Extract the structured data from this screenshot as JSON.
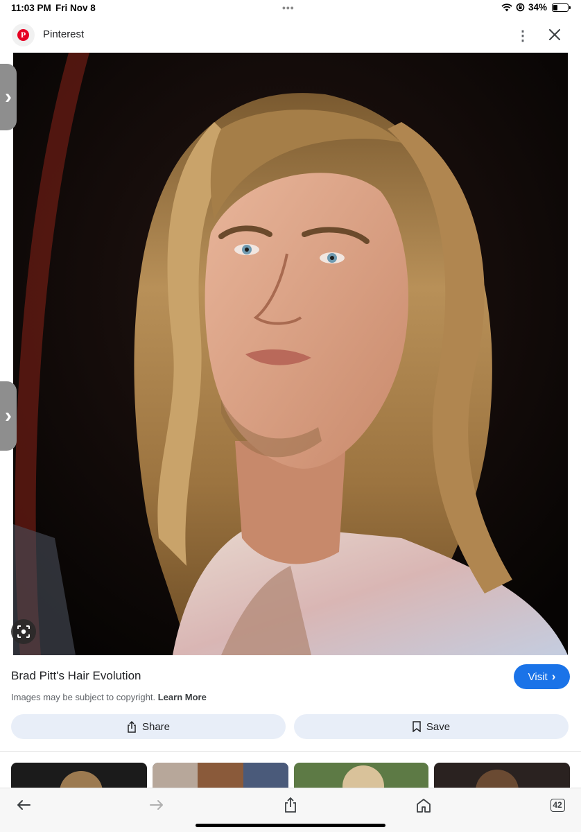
{
  "status_bar": {
    "time": "11:03 PM",
    "date": "Fri Nov 8",
    "dots": "•••",
    "battery_percent": "34%",
    "battery_level": 0.34,
    "icons": [
      "wifi-icon",
      "orientation-lock-icon",
      "battery-icon"
    ]
  },
  "header": {
    "site_name": "Pinterest",
    "logo_glyph": "P",
    "logo_color": "#e60023",
    "more_icon": "⋮",
    "close_icon": "close-icon"
  },
  "image": {
    "subject": "portrait-photo",
    "lens_icon": "lens-search-icon",
    "side_tab_icon": "›"
  },
  "result": {
    "title": "Brad Pitt's Hair Evolution",
    "visit_label": "Visit",
    "visit_chevron": "›",
    "accent_color": "#1a73e8",
    "copyright_text": "Images may be subject to copyright.",
    "learn_more": "Learn More"
  },
  "actions": {
    "share_label": "Share",
    "save_label": "Save"
  },
  "toolbar": {
    "tabs_count": "42",
    "icons": [
      "back-arrow-icon",
      "forward-arrow-icon",
      "share-icon",
      "home-icon",
      "tabs-icon"
    ]
  }
}
